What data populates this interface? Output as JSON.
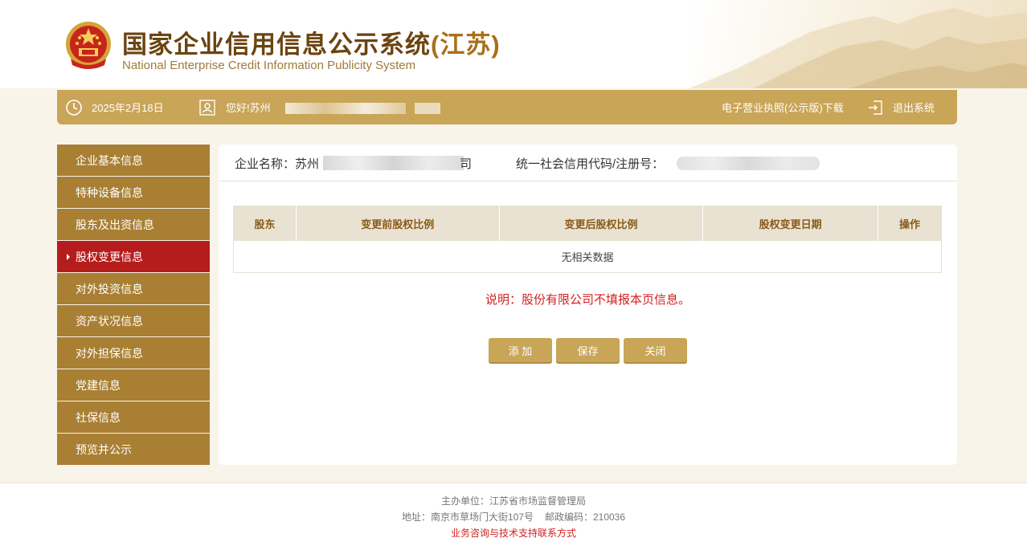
{
  "header": {
    "title_main": "国家企业信用信息公示系统",
    "title_province": "(江苏)",
    "subtitle": "National Enterprise Credit Information Publicity System"
  },
  "topbar": {
    "date": "2025年2月18日",
    "greeting": "您好!苏州",
    "download_label": "电子营业执照(公示版)下载",
    "logout_label": "退出系统"
  },
  "sidebar": {
    "items": [
      {
        "label": "企业基本信息"
      },
      {
        "label": "特种设备信息"
      },
      {
        "label": "股东及出资信息"
      },
      {
        "label": "股权变更信息",
        "active": true
      },
      {
        "label": "对外投资信息"
      },
      {
        "label": "资产状况信息"
      },
      {
        "label": "对外担保信息"
      },
      {
        "label": "党建信息"
      },
      {
        "label": "社保信息"
      },
      {
        "label": "预览并公示"
      }
    ]
  },
  "main": {
    "company_label": "企业名称：苏州",
    "company_suffix": "司",
    "credit_code_label": "统一社会信用代码/注册号：",
    "table": {
      "columns": [
        "股东",
        "变更前股权比例",
        "变更后股权比例",
        "股权变更日期",
        "操作"
      ],
      "empty_text": "无相关数据"
    },
    "note": "说明：股份有限公司不填报本页信息。",
    "buttons": {
      "add": "添 加",
      "save": "保存",
      "close": "关闭"
    }
  },
  "footer": {
    "sponsor": "主办单位：江苏省市场监督管理局",
    "address": "地址：南京市草场门大街107号",
    "postcode": "邮政编码：210036",
    "support_link": "业务咨询与技术支持联系方式"
  },
  "colors": {
    "gold": "#c9a558",
    "sidebar": "#a97f33",
    "active": "#b51d1d",
    "title": "#6b4410",
    "note_red": "#d21f1f"
  }
}
